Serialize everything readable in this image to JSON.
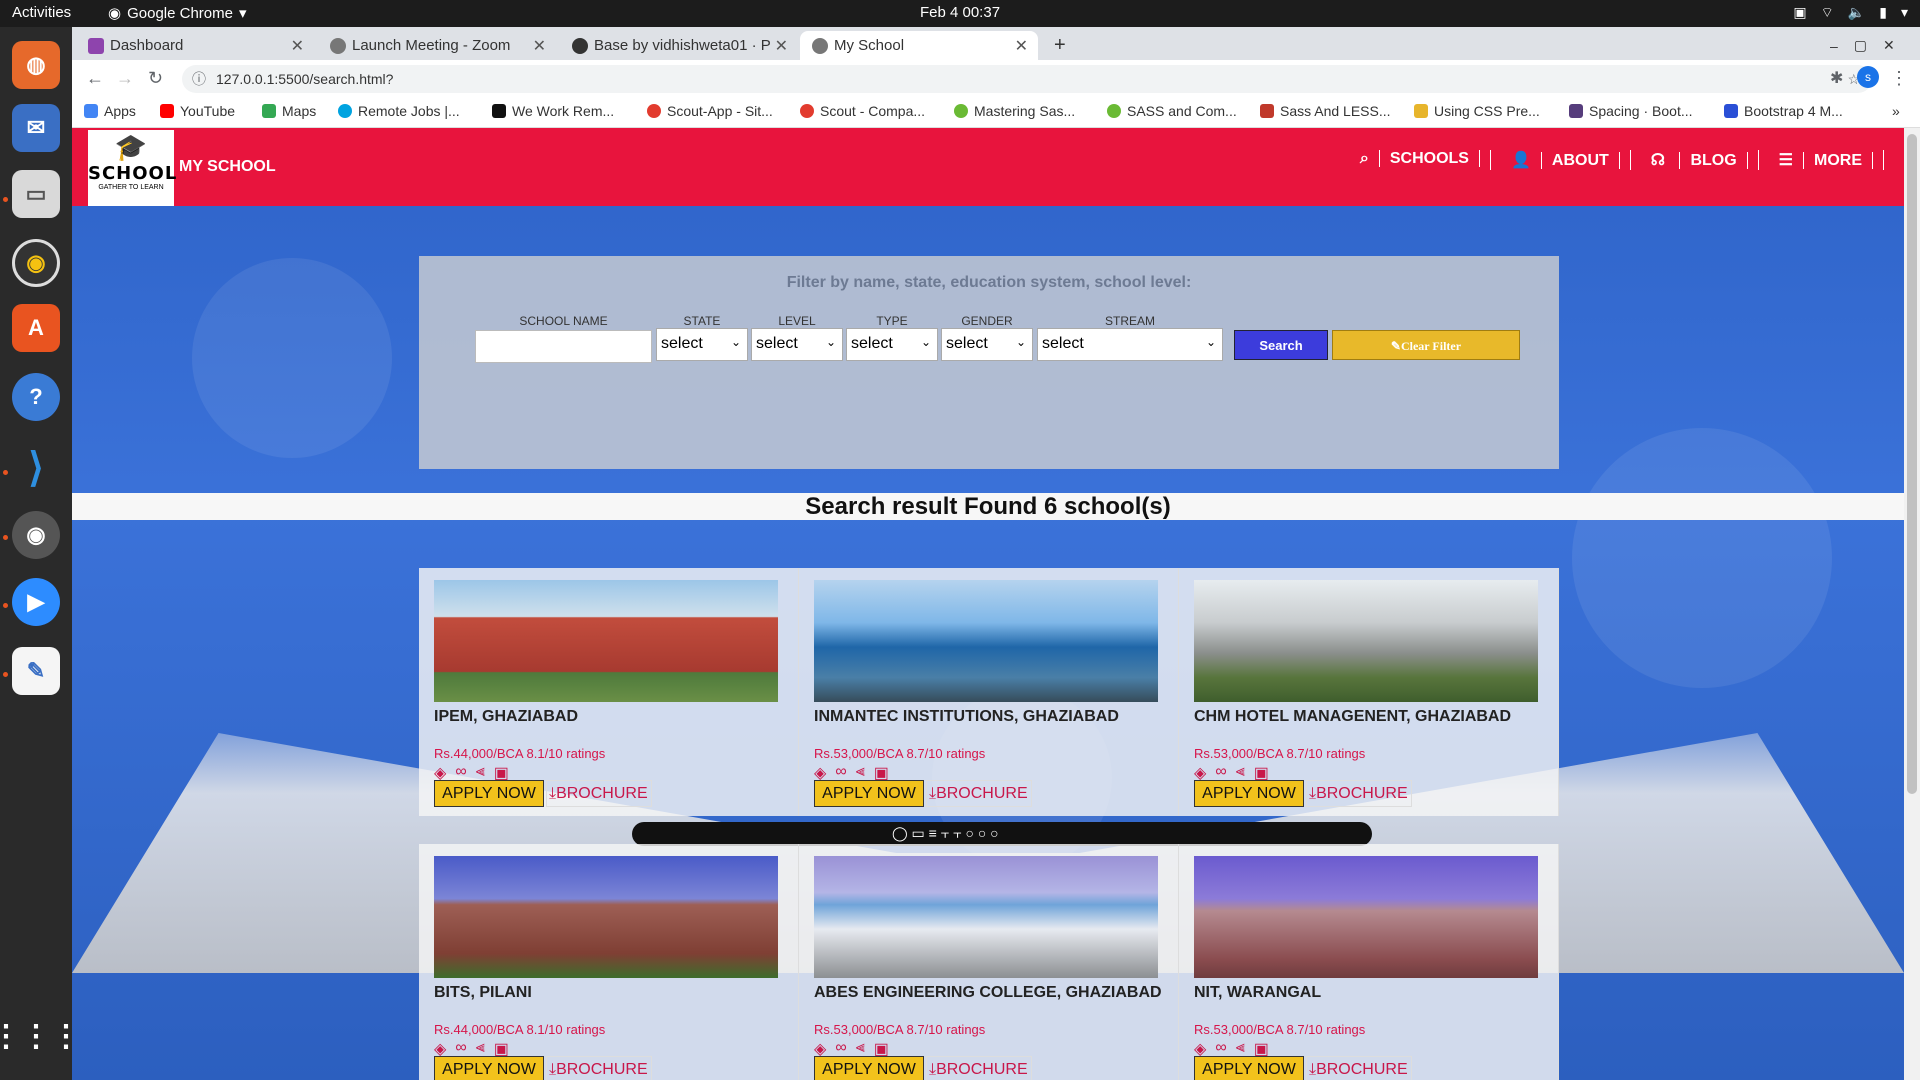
{
  "os": {
    "activities": "Activities",
    "app_name": "Google Chrome",
    "clock": "Feb 4  00:37"
  },
  "browser": {
    "tabs": [
      {
        "label": "Dashboard",
        "fav_color": "#8e44ad"
      },
      {
        "label": "Launch Meeting - Zoom",
        "fav_color": "#777777"
      },
      {
        "label": "Base by vidhishweta01 · P",
        "fav_color": "#333333"
      },
      {
        "label": "My School",
        "fav_color": "#777777"
      }
    ],
    "url": "127.0.0.1:5500/search.html?",
    "bookmarks": [
      {
        "label": "Apps",
        "color": "#4285f4"
      },
      {
        "label": "YouTube",
        "color": "#ff0000"
      },
      {
        "label": "Maps",
        "color": "#34a853"
      },
      {
        "label": "Remote Jobs |...",
        "color": "#00a3e0"
      },
      {
        "label": "We Work Rem...",
        "color": "#111111"
      },
      {
        "label": "Scout-App - Sit...",
        "color": "#e23b2e"
      },
      {
        "label": "Scout - Compa...",
        "color": "#e23b2e"
      },
      {
        "label": "Mastering Sas...",
        "color": "#6aba34"
      },
      {
        "label": "SASS and Com...",
        "color": "#6aba34"
      },
      {
        "label": "Sass And LESS...",
        "color": "#c0392b"
      },
      {
        "label": "Using CSS Pre...",
        "color": "#e7b52c"
      },
      {
        "label": "Spacing · Boot...",
        "color": "#563d7c"
      },
      {
        "label": "Bootstrap 4 M...",
        "color": "#2a4fd6"
      }
    ]
  },
  "site": {
    "logo_line1": "SCHOOL",
    "logo_line2": "GATHER TO LEARN",
    "brand": "MY SCHOOL",
    "menu": [
      "SCHOOLS",
      "ABOUT",
      "BLOG",
      "MORE"
    ],
    "accent": "#e8143d"
  },
  "filter": {
    "title": "Filter by name, state, education system, school level:",
    "labels": {
      "name": "SCHOOL NAME",
      "state": "STATE",
      "level": "LEVEL",
      "type": "TYPE",
      "gender": "GENDER",
      "stream": "STREAM"
    },
    "select_value": "select",
    "search_label": "Search",
    "clear_label": "Clear Filter"
  },
  "result_text": "Search result Found 6 school(s)",
  "schools": [
    {
      "name": "IPEM, GHAZIABAD",
      "price": "Rs.44,000/BCA  8.1/10 ratings"
    },
    {
      "name": "INMANTEC INSTITUTIONS, GHAZIABAD",
      "price": "Rs.53,000/BCA 8.7/10 ratings"
    },
    {
      "name": "CHM HOTEL MANAGENENT, GHAZIABAD",
      "price": "Rs.53,000/BCA 8.7/10 ratings"
    },
    {
      "name": "BITS, PILANI",
      "price": "Rs.44,000/BCA  8.1/10 ratings"
    },
    {
      "name": "ABES ENGINEERING COLLEGE, GHAZIABAD",
      "price": "Rs.53,000/BCA 8.7/10 ratings"
    },
    {
      "name": "NIT, WARANGAL",
      "price": "Rs.53,000/BCA 8.7/10 ratings"
    }
  ],
  "card_actions": {
    "apply": "APPLY NOW",
    "brochure": "BROCHURE"
  }
}
